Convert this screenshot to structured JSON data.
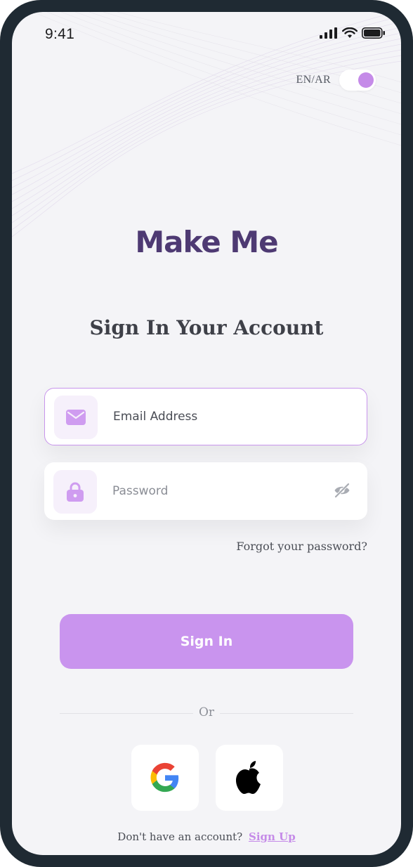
{
  "status_bar": {
    "time": "9:41"
  },
  "language_toggle": {
    "label": "EN/AR",
    "state": "on"
  },
  "app": {
    "logo_text": "Make Me"
  },
  "page": {
    "title": "Sign In Your Account"
  },
  "form": {
    "email_placeholder": "Email Address",
    "email_value": "",
    "password_placeholder": "Password",
    "password_value": "",
    "forgot_password": "Forgot your password?",
    "submit_label": "Sign In"
  },
  "divider": {
    "label": "Or"
  },
  "social": {
    "google_icon": "google-icon",
    "apple_icon": "apple-icon"
  },
  "footer": {
    "prompt": "Don't have an account?",
    "link_label": "Sign Up"
  },
  "colors": {
    "accent": "#c994ee",
    "logo": "#4e3a73",
    "background": "#f4f4f7",
    "frame": "#1f2a33"
  }
}
